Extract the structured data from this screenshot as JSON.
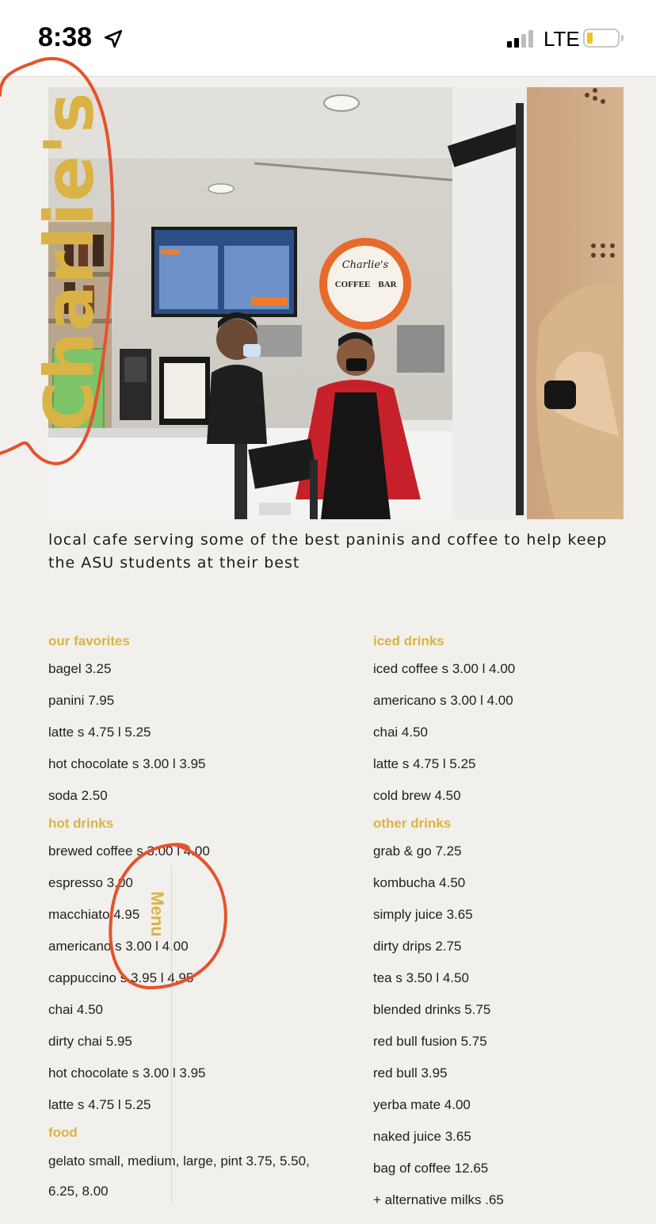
{
  "status_bar": {
    "time": "8:38",
    "network": "LTE",
    "signal_bars_active": 2,
    "battery_level_percent": 15
  },
  "brand": {
    "name": "Charlie's"
  },
  "hero_image": {
    "sign_line1": "Charlie's",
    "sign_line2": "COFFEE",
    "sign_line3": "BAR"
  },
  "tagline": "local cafe serving some of the best paninis and coffee to help keep the ASU students at their best",
  "menu_vertical_label": "Menu",
  "menu": {
    "left": [
      {
        "category": "our favorites",
        "items": [
          "bagel 3.25",
          "panini 7.95",
          "latte s 4.75 l 5.25",
          "hot chocolate s 3.00 l 3.95",
          "soda 2.50"
        ]
      },
      {
        "category": "hot drinks",
        "items": [
          "brewed coffee s 3.00 l 4.00",
          "espresso 3.00",
          "macchiato 4.95",
          "americano s 3.00 l 4.00",
          "cappuccino s 3.95 l 4.95",
          "chai 4.50",
          "dirty chai 5.95",
          "hot chocolate s 3.00 l 3.95",
          "latte s 4.75 l 5.25"
        ]
      },
      {
        "category": "food",
        "items": [
          "gelato small, medium, large, pint 3.75, 5.50, 6.25, 8.00"
        ]
      }
    ],
    "right": [
      {
        "category": "iced drinks",
        "items": [
          "iced coffee s 3.00 l 4.00",
          "americano s 3.00 l 4.00",
          "chai 4.50",
          "latte s 4.75 l 5.25",
          "cold brew 4.50"
        ]
      },
      {
        "category": "other drinks",
        "items": [
          "grab & go 7.25",
          "kombucha 4.50",
          "simply juice 3.65",
          "dirty drips 2.75",
          "tea s 3.50 l 4.50",
          "blended drinks 5.75",
          "red bull fusion 5.75",
          "red bull 3.95",
          "yerba mate 4.00",
          "naked juice 3.65",
          "bag of coffee 12.65",
          "+ alternative milks .65"
        ]
      }
    ]
  },
  "colors": {
    "accent": "#dab346",
    "background": "#f2f0ec",
    "annotation": "#e5522d"
  }
}
